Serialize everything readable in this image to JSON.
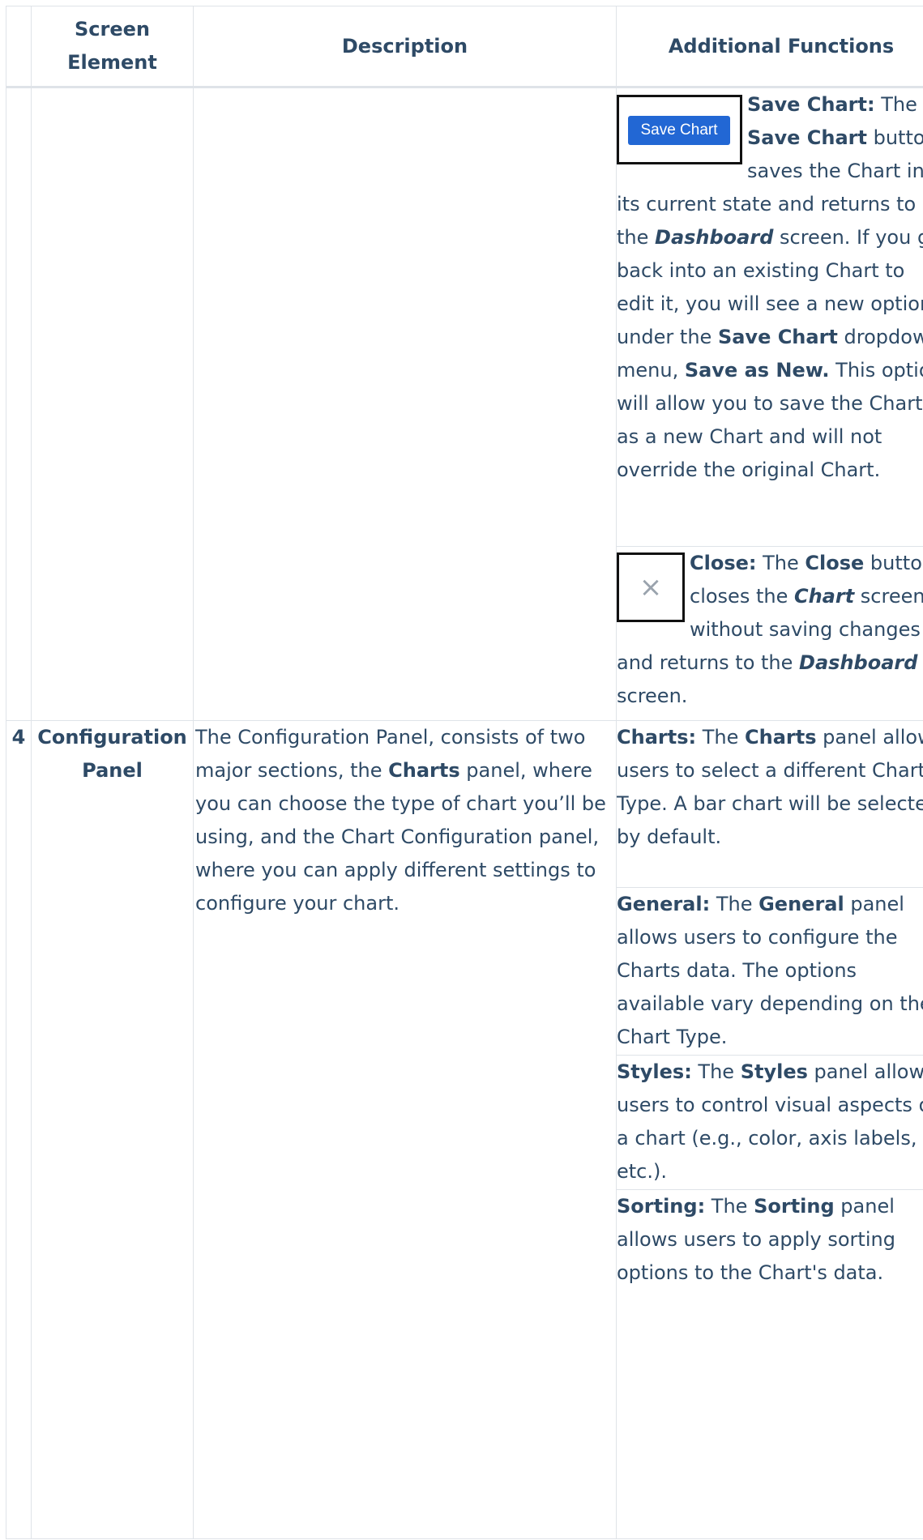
{
  "table": {
    "headers": {
      "number": "",
      "screen_element": "Screen Element",
      "description": "Description",
      "additional_functions": "Additional Functions"
    },
    "rows": [
      {
        "number": "",
        "screen_element": "",
        "description": "",
        "functions": [
          {
            "thumbnail": "save-chart-button-image",
            "thumbnail_label": "Save Chart",
            "label": "Save Chart:",
            "t1": " The ",
            "b1": "Save Chart",
            "t2": " button saves the Chart in its current state and returns to the ",
            "bi1": "Dashboard",
            "t3": " screen. If you go back into an existing Chart to edit it, you will see a new option under the ",
            "b2": "Save Chart",
            "t4": " dropdown menu, ",
            "b3": "Save as New.",
            "t5": " This option will allow you to save the Chart as a new Chart and will not override the original Chart."
          },
          {
            "thumbnail": "close-icon",
            "thumbnail_label": "×",
            "label": "Close:",
            "t1": " The ",
            "b1": "Close",
            "t2": " button closes the ",
            "bi1": "Chart",
            "t3": " screen without saving changes and returns to the ",
            "bi2": "Dashboard",
            "t4": " screen."
          }
        ]
      },
      {
        "number": "4",
        "screen_element": "Configuration Panel",
        "description": {
          "t1": "The Configuration Panel, consists of two major sections, the ",
          "b1": "Charts",
          "t2": " panel, where you can choose the type of chart you’ll be using, and the Chart Configuration panel, where you can apply different settings to configure your chart."
        },
        "functions": [
          {
            "label": "Charts:",
            "t1": " The ",
            "b1": "Charts",
            "t2": " panel allows users to select a different Chart Type. A bar chart will be selected by default."
          },
          {
            "label": "General:",
            "t1": " The ",
            "b1": "General",
            "t2": " panel allows users to configure the Charts data. The options available vary depending on the Chart Type."
          },
          {
            "label": "Styles:",
            "t1": " The ",
            "b1": "Styles",
            "t2": " panel allows users to control visual aspects of a chart (e.g., color, axis labels, etc.)."
          },
          {
            "label": "Sorting:",
            "t1": " The ",
            "b1": "Sorting",
            "t2": " panel allows users to apply sorting options to the Chart's data."
          }
        ]
      }
    ]
  }
}
